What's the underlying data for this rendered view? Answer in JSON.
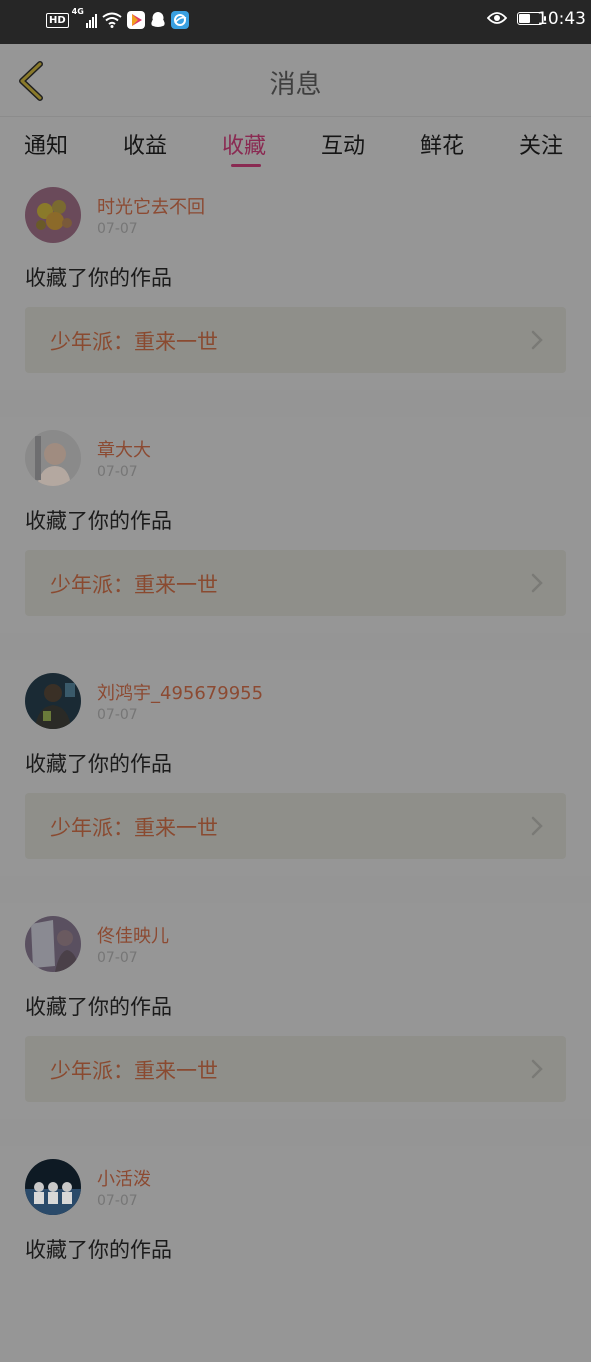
{
  "status_bar": {
    "hd_label": "HD",
    "network_label": "4G",
    "time": "10:43",
    "battery_level": 0.45,
    "icons": [
      "hd-icon",
      "signal-icon",
      "wifi-icon",
      "video-app-icon",
      "qq-icon",
      "browser-app-icon",
      "eye-icon",
      "battery-icon"
    ]
  },
  "header": {
    "title": "消息",
    "back_icon": "chevron-left-icon"
  },
  "tabs": [
    {
      "label": "通知",
      "active": false
    },
    {
      "label": "收益",
      "active": false
    },
    {
      "label": "收藏",
      "active": true
    },
    {
      "label": "互动",
      "active": false
    },
    {
      "label": "鲜花",
      "active": false
    },
    {
      "label": "关注",
      "active": false
    }
  ],
  "messages": [
    {
      "user": "时光它去不回",
      "date": "07-07",
      "action": "收藏了你的作品",
      "work": "少年派：重来一世"
    },
    {
      "user": "章大大",
      "date": "07-07",
      "action": "收藏了你的作品",
      "work": "少年派：重来一世"
    },
    {
      "user": "刘鸿宇_495679955",
      "date": "07-07",
      "action": "收藏了你的作品",
      "work": "少年派：重来一世"
    },
    {
      "user": "佟佳映儿",
      "date": "07-07",
      "action": "收藏了你的作品",
      "work": "少年派：重来一世"
    },
    {
      "user": "小活泼",
      "date": "07-07",
      "action": "收藏了你的作品",
      "work": ""
    }
  ],
  "colors": {
    "accent": "#8a2a52",
    "username": "#8c4a32",
    "overlay_background": "#969696"
  }
}
